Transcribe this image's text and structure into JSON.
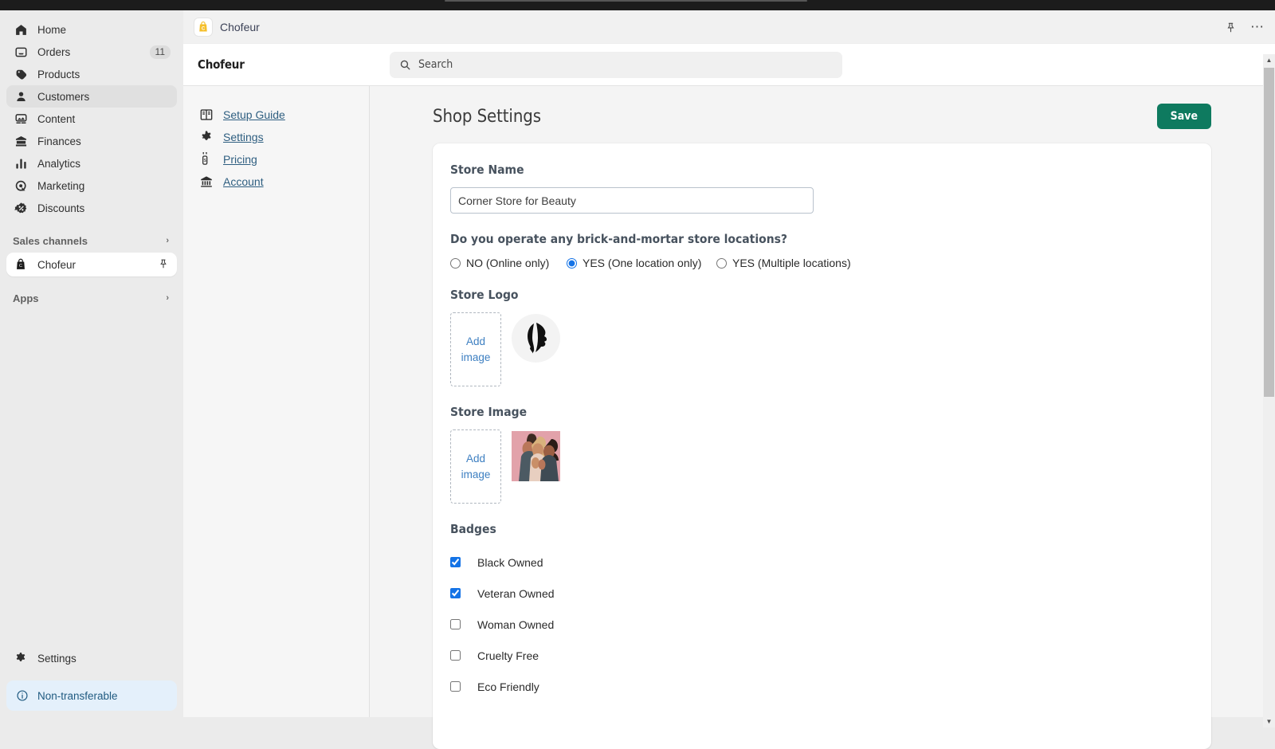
{
  "global_sidebar": {
    "items": [
      {
        "label": "Home",
        "icon": "home-icon",
        "badge": "",
        "selected": false
      },
      {
        "label": "Orders",
        "icon": "orders-inbox-icon",
        "badge": "11",
        "selected": false
      },
      {
        "label": "Products",
        "icon": "product-tag-icon",
        "badge": "",
        "selected": false
      },
      {
        "label": "Customers",
        "icon": "customer-person-icon",
        "badge": "",
        "selected": true
      },
      {
        "label": "Content",
        "icon": "content-image-icon",
        "badge": "",
        "selected": false
      },
      {
        "label": "Finances",
        "icon": "finances-bank-icon",
        "badge": "",
        "selected": false
      },
      {
        "label": "Analytics",
        "icon": "analytics-bars-icon",
        "badge": "",
        "selected": false
      },
      {
        "label": "Marketing",
        "icon": "marketing-target-icon",
        "badge": "",
        "selected": false
      },
      {
        "label": "Discounts",
        "icon": "discount-percent-icon",
        "badge": "",
        "selected": false
      }
    ],
    "sales_channels_section": {
      "label": "Sales channels",
      "chevron": "chevron-right-icon"
    },
    "channel": {
      "label": "Chofeur",
      "icon": "chofeur-shop-icon",
      "pin": "pin-icon"
    },
    "apps_section": {
      "label": "Apps",
      "chevron": "chevron-right-icon"
    },
    "settings": {
      "label": "Settings",
      "icon": "gear-icon"
    },
    "notice": {
      "label": "Non-transferable",
      "icon": "info-circle-icon",
      "bg": "#e4f0fb",
      "fg": "#1f5a80"
    }
  },
  "app_titlebar": {
    "app_name": "Chofeur",
    "logo_icon": "chofeur-bag-logo",
    "pin_icon": "pin-icon",
    "more_icon": "ellipsis-icon"
  },
  "app_subheader": {
    "store_label": "Chofeur",
    "search": {
      "placeholder": "Search",
      "value": "",
      "icon": "search-icon"
    }
  },
  "app_menu": {
    "items": [
      {
        "label": "Setup Guide",
        "icon": "book-guide-icon"
      },
      {
        "label": "Settings",
        "icon": "gear-icon"
      },
      {
        "label": "Pricing",
        "icon": "price-tag-icon"
      },
      {
        "label": "Account",
        "icon": "bank-icon"
      }
    ],
    "link_color": "#2e5e80"
  },
  "main": {
    "page_title": "Shop Settings",
    "save_label": "Save",
    "save_color": "#0e7a5f",
    "store_name": {
      "label": "Store Name",
      "value": "Corner Store for Beauty",
      "placeholder": ""
    },
    "locations_question": {
      "label": "Do you operate any brick-and-mortar store locations?",
      "options": [
        {
          "label": "NO (Online only)",
          "checked": false
        },
        {
          "label": "YES (One location only)",
          "checked": true
        },
        {
          "label": "YES (Multiple locations)",
          "checked": false
        }
      ]
    },
    "store_logo": {
      "label": "Store Logo",
      "add_image_line1": "Add",
      "add_image_line2": "image",
      "thumbnail_alt": "face-silhouette-logo"
    },
    "store_image": {
      "label": "Store Image",
      "add_image_line1": "Add",
      "add_image_line2": "image",
      "thumbnail_alt": "three-women-photo"
    },
    "badges": {
      "label": "Badges",
      "items": [
        {
          "label": "Black Owned",
          "checked": true
        },
        {
          "label": "Veteran Owned",
          "checked": true
        },
        {
          "label": "Woman Owned",
          "checked": false
        },
        {
          "label": "Cruelty Free",
          "checked": false
        },
        {
          "label": "Eco Friendly",
          "checked": false
        }
      ]
    }
  },
  "scrollbar": {
    "up": "▲",
    "down": "▼"
  }
}
